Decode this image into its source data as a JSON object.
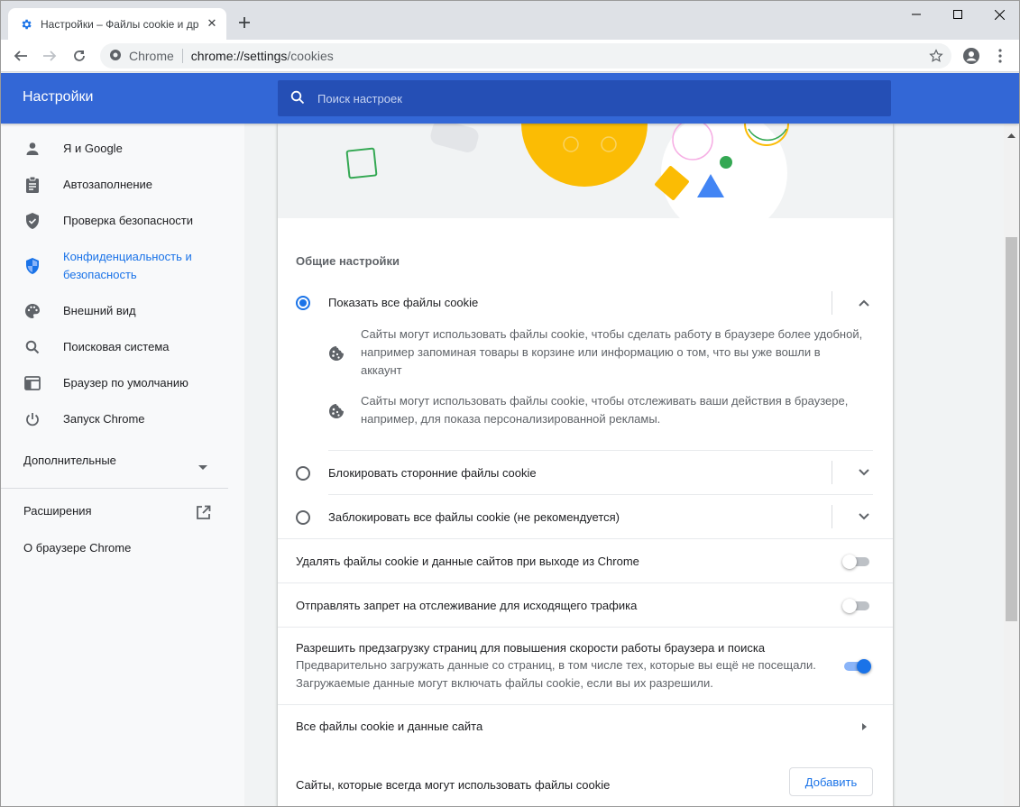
{
  "browser": {
    "tab_title": "Настройки – Файлы cookie и др",
    "omnibox_site": "Chrome",
    "omnibox_scheme_host": "chrome://settings",
    "omnibox_path": "/cookies"
  },
  "header": {
    "title": "Настройки",
    "search_placeholder": "Поиск настроек"
  },
  "sidebar": {
    "items": [
      {
        "label": "Я и Google",
        "icon": "person-icon"
      },
      {
        "label": "Автозаполнение",
        "icon": "clipboard-icon"
      },
      {
        "label": "Проверка безопасности",
        "icon": "shield-check-icon"
      },
      {
        "label_line1": "Конфиденциальность и",
        "label_line2": "безопасность",
        "icon": "privacy-shield-icon",
        "active": true
      },
      {
        "label": "Внешний вид",
        "icon": "palette-icon"
      },
      {
        "label": "Поисковая система",
        "icon": "search-icon"
      },
      {
        "label": "Браузер по умолчанию",
        "icon": "browser-icon"
      },
      {
        "label": "Запуск Chrome",
        "icon": "power-icon"
      }
    ],
    "advanced": "Дополнительные",
    "extensions": "Расширения",
    "about": "О браузере Chrome"
  },
  "main": {
    "general_title": "Общие настройки",
    "options": [
      {
        "label": "Показать все файлы cookie",
        "checked": true,
        "expanded": true
      },
      {
        "label": "Блокировать сторонние файлы cookie",
        "checked": false
      },
      {
        "label": "Заблокировать все файлы cookie (не рекомендуется)",
        "checked": false
      }
    ],
    "desc1_line1": "Сайты могут использовать файлы cookie, чтобы сделать работу в браузере более удобной,",
    "desc1_line2": "например запоминая товары в корзине или информацию о том, что вы уже вошли в",
    "desc1_line3": "аккаунт",
    "desc2_line1": "Сайты могут использовать файлы cookie, чтобы отслеживать ваши действия в браузере,",
    "desc2_line2": "например, для показа персонализированной рекламы.",
    "clear_on_exit": {
      "label": "Удалять файлы cookie и данные сайтов при выходе из Chrome",
      "on": false
    },
    "do_not_track": {
      "label": "Отправлять запрет на отслеживание для исходящего трафика",
      "on": false
    },
    "preload": {
      "label": "Разрешить предзагрузку страниц для повышения скорости работы браузера и поиска",
      "sub1": "Предварительно загружать данные со страниц, в том числе тех, которые вы ещё не посещали.",
      "sub2": "Загружаемые данные могут включать файлы cookie, если вы их разрешили.",
      "on": true
    },
    "all_cookies": "Все файлы cookie и данные сайта",
    "always_allow": "Сайты, которые всегда могут использовать файлы cookie",
    "add_button": "Добавить"
  },
  "colors": {
    "header": "#3367d6",
    "accent": "#1a73e8"
  }
}
